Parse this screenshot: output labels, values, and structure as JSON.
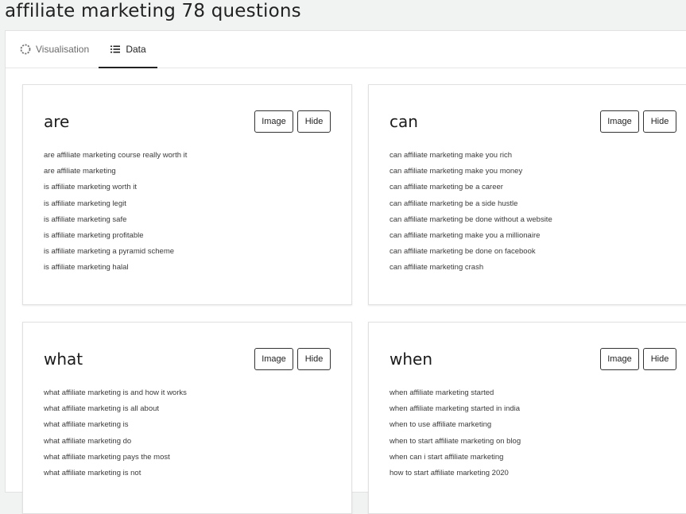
{
  "page": {
    "title": "affiliate marketing 78 questions"
  },
  "tabs": [
    {
      "label": "Visualisation",
      "icon": "spinner-circle-icon",
      "active": false
    },
    {
      "label": "Data",
      "icon": "list-icon",
      "active": true
    }
  ],
  "buttons": {
    "image": "Image",
    "hide": "Hide"
  },
  "cards": [
    {
      "title": "are",
      "questions": [
        "are affiliate marketing course really worth it",
        "are affiliate marketing",
        "is affiliate marketing worth it",
        "is affiliate marketing legit",
        "is affiliate marketing safe",
        "is affiliate marketing profitable",
        "is affiliate marketing a pyramid scheme",
        "is affiliate marketing halal"
      ]
    },
    {
      "title": "can",
      "questions": [
        "can affiliate marketing make you rich",
        "can affiliate marketing make you money",
        "can affiliate marketing be a career",
        "can affiliate marketing be a side hustle",
        "can affiliate marketing be done without a website",
        "can affiliate marketing make you a millionaire",
        "can affiliate marketing be done on facebook",
        "can affiliate marketing crash"
      ]
    },
    {
      "title": "what",
      "questions": [
        "what affiliate marketing is and how it works",
        "what affiliate marketing is all about",
        "what affiliate marketing is",
        "what affiliate marketing do",
        "what affiliate marketing pays the most",
        "what affiliate marketing is not"
      ]
    },
    {
      "title": "when",
      "questions": [
        "when affiliate marketing started",
        "when affiliate marketing started in india",
        "when to use affiliate marketing",
        "when to start affiliate marketing on blog",
        "when can i start affiliate marketing",
        "how to start affiliate marketing 2020"
      ]
    }
  ]
}
